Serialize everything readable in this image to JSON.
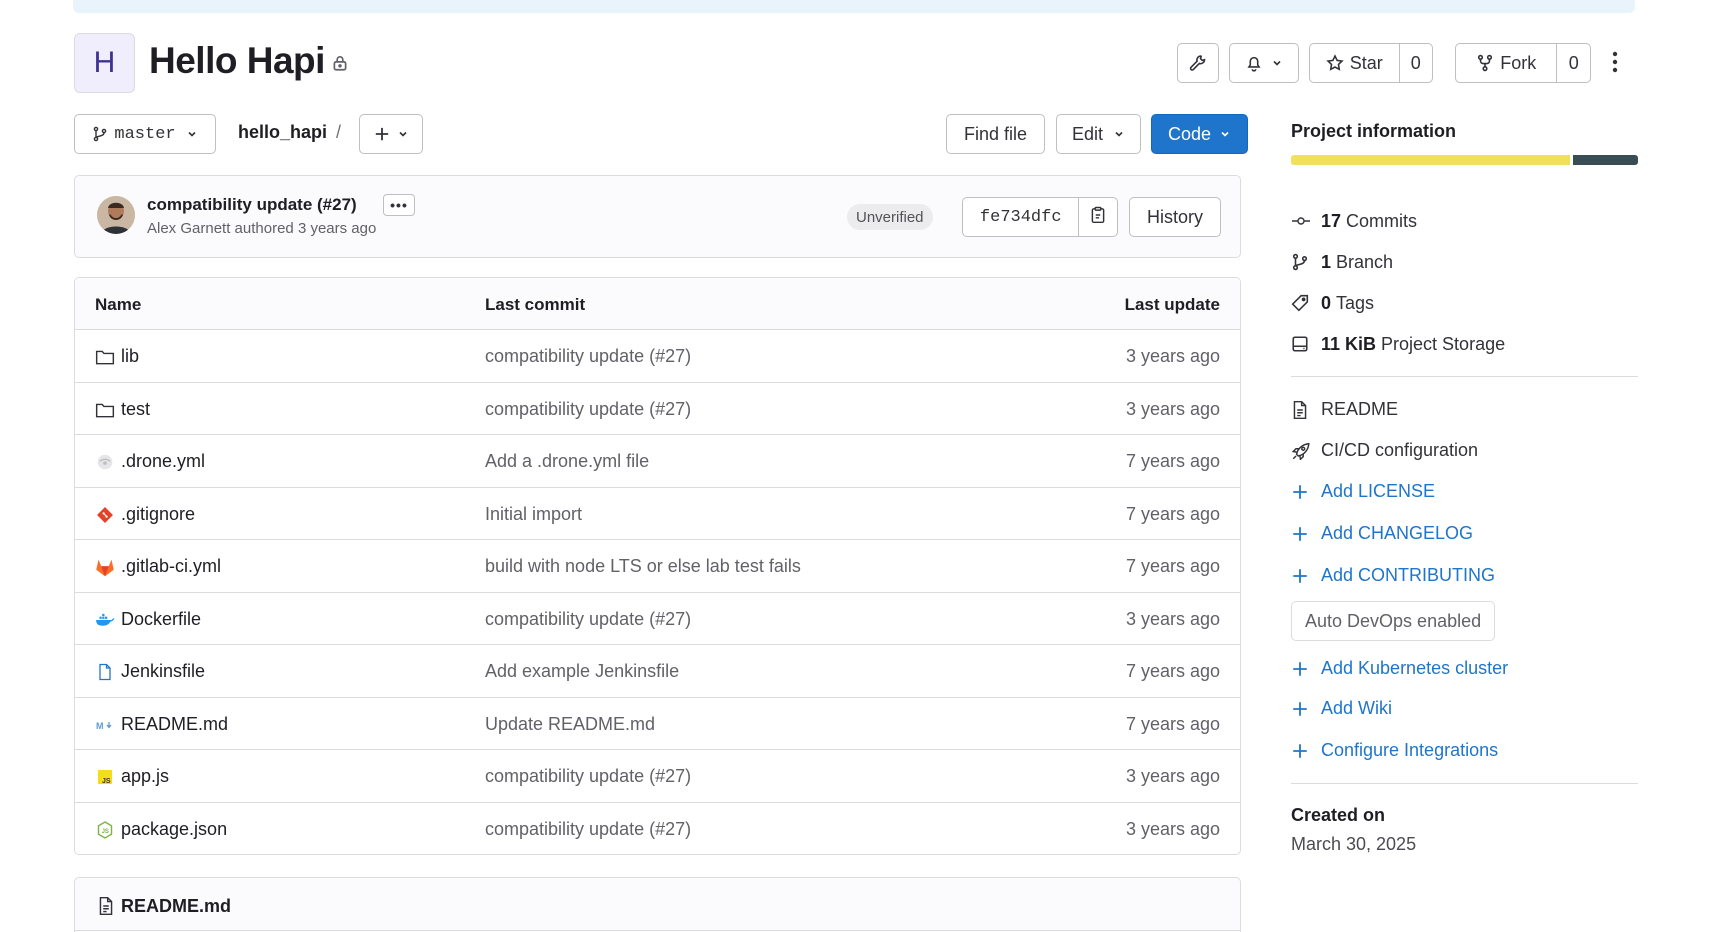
{
  "project": {
    "avatar_letter": "H",
    "title": "Hello Hapi"
  },
  "header": {
    "star_label": "Star",
    "star_count": "0",
    "fork_label": "Fork",
    "fork_count": "0"
  },
  "toolbar": {
    "branch": "master",
    "breadcrumb": "hello_hapi",
    "breadcrumb_sep": "/",
    "find_file": "Find file",
    "edit": "Edit",
    "code": "Code"
  },
  "last_commit": {
    "title": "compatibility update (#27)",
    "more": "•••",
    "author": "Alex Garnett",
    "authored_text": "authored",
    "time": "3 years ago",
    "status": "Unverified",
    "sha": "fe734dfc",
    "history": "History"
  },
  "table": {
    "headers": [
      "Name",
      "Last commit",
      "Last update"
    ],
    "rows": [
      {
        "name": "lib",
        "icon": "folder-icon",
        "commit": "compatibility update (#27)",
        "date": "3 years ago"
      },
      {
        "name": "test",
        "icon": "folder-icon",
        "commit": "compatibility update (#27)",
        "date": "3 years ago"
      },
      {
        "name": ".drone.yml",
        "icon": "drone-icon",
        "commit": "Add a .drone.yml file",
        "date": "7 years ago"
      },
      {
        "name": ".gitignore",
        "icon": "git-icon",
        "commit": "Initial import",
        "date": "7 years ago"
      },
      {
        "name": ".gitlab-ci.yml",
        "icon": "gitlab-icon",
        "commit": "build with node LTS or else lab test fails",
        "date": "7 years ago"
      },
      {
        "name": "Dockerfile",
        "icon": "docker-icon",
        "commit": "compatibility update (#27)",
        "date": "3 years ago"
      },
      {
        "name": "Jenkinsfile",
        "icon": "file-icon",
        "commit": "Add example Jenkinsfile",
        "date": "7 years ago"
      },
      {
        "name": "README.md",
        "icon": "markdown-icon",
        "commit": "Update README.md",
        "date": "7 years ago"
      },
      {
        "name": "app.js",
        "icon": "js-icon",
        "commit": "compatibility update (#27)",
        "date": "3 years ago"
      },
      {
        "name": "package.json",
        "icon": "nodejs-icon",
        "commit": "compatibility update (#27)",
        "date": "3 years ago"
      }
    ]
  },
  "readme": {
    "title": "README.md"
  },
  "sidebar": {
    "title": "Project information",
    "language_shares": [
      0.81,
      0.19
    ],
    "language_colors": [
      "#f1e05a",
      "#384d54"
    ],
    "stats": [
      {
        "count": "17",
        "label": "Commits",
        "icon": "commit-icon"
      },
      {
        "count": "1",
        "label": "Branch",
        "icon": "branch-icon"
      },
      {
        "count": "0",
        "label": "Tags",
        "icon": "tag-icon"
      },
      {
        "count": "11 KiB",
        "label": "Project Storage",
        "icon": "storage-icon"
      }
    ],
    "links": {
      "readme": "README",
      "cicd": "CI/CD configuration",
      "license": "Add LICENSE",
      "changelog": "Add CHANGELOG",
      "contributing": "Add CONTRIBUTING",
      "autodevops": "Auto DevOps enabled",
      "kubernetes": "Add Kubernetes cluster",
      "wiki": "Add Wiki",
      "integrations": "Configure Integrations"
    },
    "created_label": "Created on",
    "created_value": "March 30, 2025"
  },
  "colors": {
    "primary": "#1f75cb",
    "link": "#1f75cb",
    "border": "#dcdcde"
  }
}
